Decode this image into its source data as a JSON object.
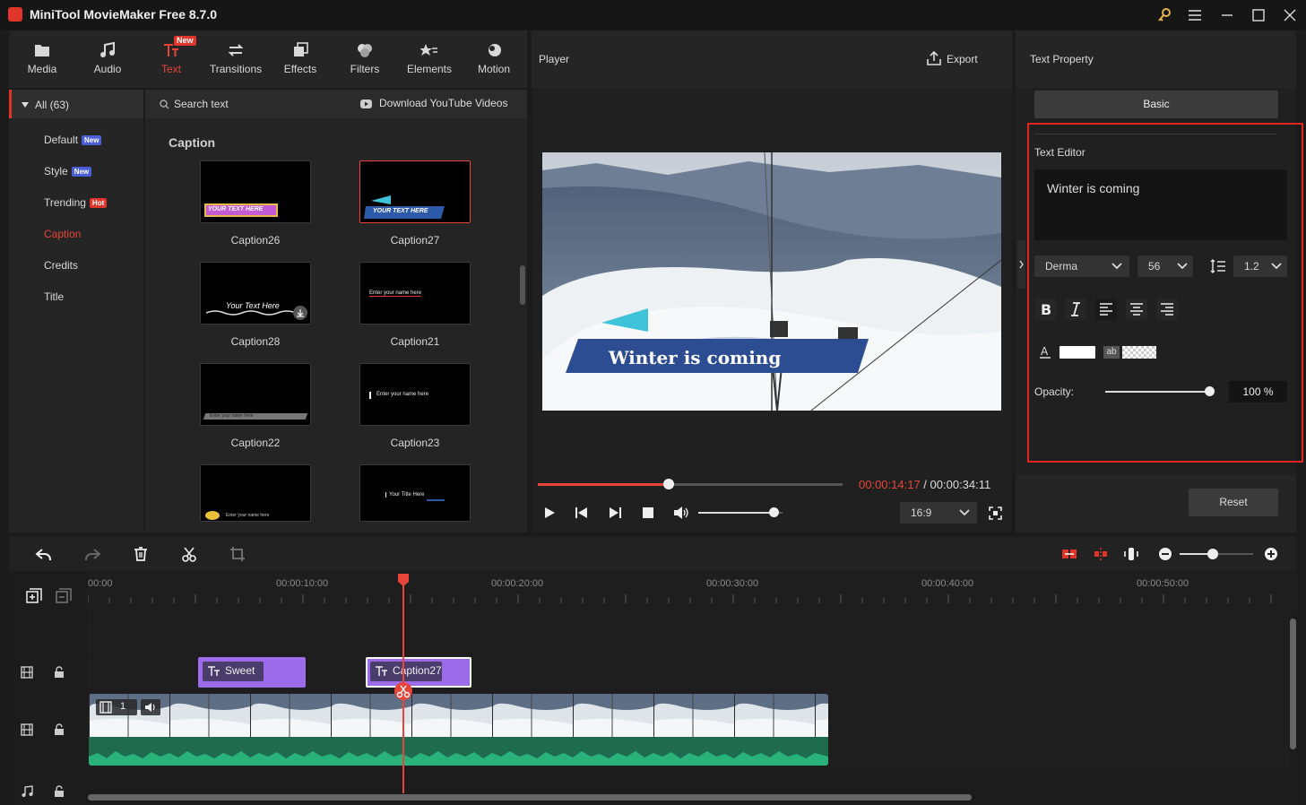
{
  "app": {
    "title": "MiniTool MovieMaker Free 8.7.0"
  },
  "media_tabs": [
    {
      "label": "Media",
      "icon": "media-icon"
    },
    {
      "label": "Audio",
      "icon": "music-note-icon"
    },
    {
      "label": "Text",
      "icon": "text-icon",
      "active": true,
      "badge": "New"
    },
    {
      "label": "Transitions",
      "icon": "transitions-icon"
    },
    {
      "label": "Effects",
      "icon": "effects-icon"
    },
    {
      "label": "Filters",
      "icon": "filters-icon"
    },
    {
      "label": "Elements",
      "icon": "elements-icon"
    },
    {
      "label": "Motion",
      "icon": "motion-icon"
    }
  ],
  "categories": {
    "all": "All (63)",
    "items": [
      {
        "label": "Default",
        "badge": "New"
      },
      {
        "label": "Style",
        "badge": "New"
      },
      {
        "label": "Trending",
        "badge": "Hot"
      },
      {
        "label": "Caption",
        "active": true
      },
      {
        "label": "Credits"
      },
      {
        "label": "Title"
      }
    ]
  },
  "library": {
    "search_placeholder": "Search text",
    "download_label": "Download YouTube Videos",
    "section": "Caption",
    "items": [
      {
        "label": "Caption26",
        "thumb_text": "YOUR TEXT HERE"
      },
      {
        "label": "Caption27",
        "thumb_text": "YOUR TEXT HERE",
        "selected": true
      },
      {
        "label": "Caption28",
        "thumb_text": "Your Text Here"
      },
      {
        "label": "Caption21",
        "thumb_text": "Enter your name here"
      },
      {
        "label": "Caption22",
        "thumb_text": "Enter your name here"
      },
      {
        "label": "Caption23",
        "thumb_text": "Enter your name here"
      },
      {
        "label": "",
        "thumb_text": "Enter your name here"
      },
      {
        "label": "",
        "thumb_text": "Your Title Here"
      }
    ]
  },
  "player": {
    "title": "Player",
    "export_label": "Export",
    "overlay_text": "Winter is coming",
    "current_time": "00:00:14:17",
    "separator": " / ",
    "total_time": "00:00:34:11",
    "progress": 0.43,
    "volume": 0.9,
    "aspect": "16:9"
  },
  "properties": {
    "title": "Text Property",
    "tab_basic": "Basic",
    "editor_label": "Text Editor",
    "editor_text": "Winter is coming",
    "font": "Derma",
    "size": "56",
    "line_spacing": "1.2",
    "opacity_label": "Opacity:",
    "opacity_value": "100 %",
    "opacity": 1.0,
    "bg_swatch_text": "ab",
    "reset_label": "Reset"
  },
  "timeline": {
    "ticks": [
      "00:00",
      "00:00:10:00",
      "00:00:20:00",
      "00:00:30:00",
      "00:00:40:00",
      "00:00:50:00"
    ],
    "clips": [
      {
        "label": "Sweet"
      },
      {
        "label": "Caption27",
        "selected": true
      }
    ],
    "video_clip_badge": "1",
    "zoom": 0.45
  },
  "colors": {
    "accent": "#e8443a",
    "clip": "#9b6bea",
    "audio": "#29b37a"
  }
}
